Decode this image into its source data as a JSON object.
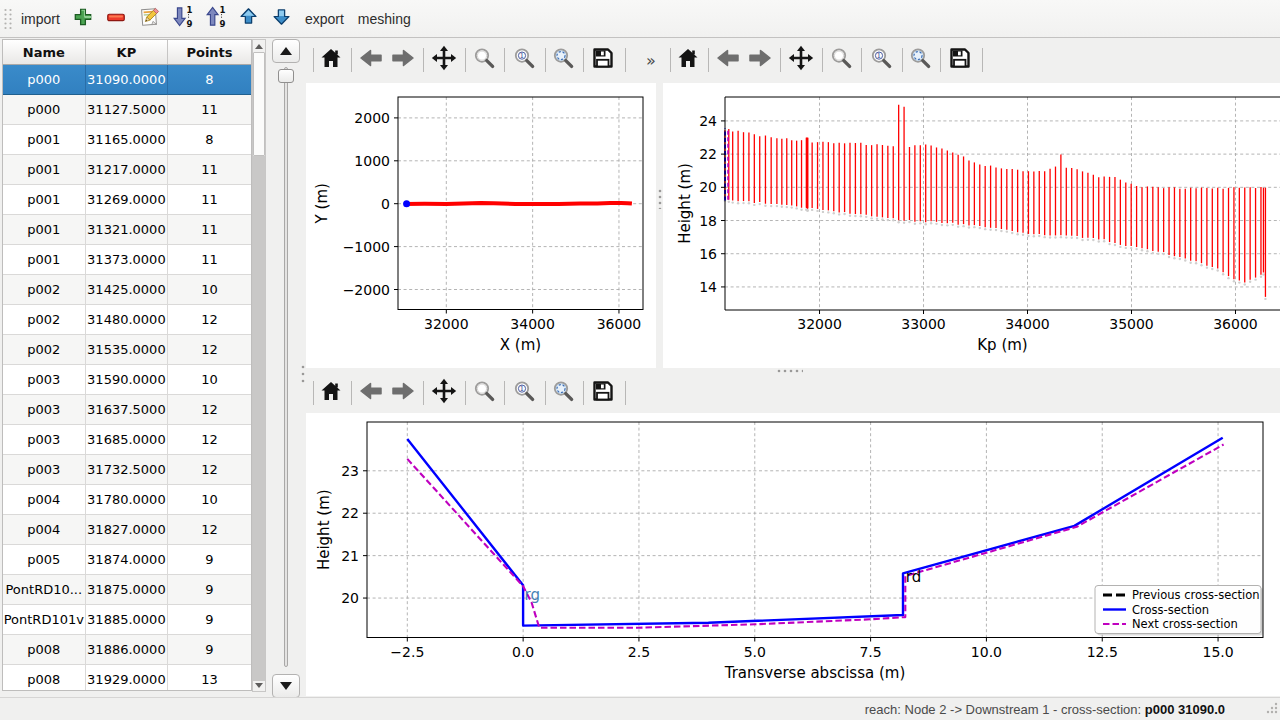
{
  "app": {
    "background": "#f0f0ef",
    "accent": "#3584c6"
  },
  "menubar": {
    "items": [
      {
        "kind": "label",
        "id": "import",
        "label": "import"
      },
      {
        "kind": "icon",
        "id": "add",
        "icon": "add-icon"
      },
      {
        "kind": "icon",
        "id": "delete",
        "icon": "remove-icon"
      },
      {
        "kind": "icon",
        "id": "edit",
        "icon": "edit-icon"
      },
      {
        "kind": "icon",
        "id": "sort-descending",
        "icon": "sort-descending-icon"
      },
      {
        "kind": "icon",
        "id": "sort-ascending",
        "icon": "sort-ascending-icon"
      },
      {
        "kind": "icon",
        "id": "move-up",
        "icon": "arrow-up-icon"
      },
      {
        "kind": "icon",
        "id": "move-down",
        "icon": "arrow-down-icon"
      },
      {
        "kind": "label",
        "id": "export",
        "label": "export"
      },
      {
        "kind": "label",
        "id": "meshing",
        "label": "meshing"
      }
    ]
  },
  "table": {
    "columns": [
      "Name",
      "KP",
      "Points"
    ],
    "selected_row": 0,
    "rows": [
      [
        "p000",
        "31090.0000",
        "8"
      ],
      [
        "p000",
        "31127.5000",
        "11"
      ],
      [
        "p001",
        "31165.0000",
        "8"
      ],
      [
        "p001",
        "31217.0000",
        "11"
      ],
      [
        "p001",
        "31269.0000",
        "11"
      ],
      [
        "p001",
        "31321.0000",
        "11"
      ],
      [
        "p001",
        "31373.0000",
        "11"
      ],
      [
        "p002",
        "31425.0000",
        "10"
      ],
      [
        "p002",
        "31480.0000",
        "12"
      ],
      [
        "p002",
        "31535.0000",
        "12"
      ],
      [
        "p003",
        "31590.0000",
        "10"
      ],
      [
        "p003",
        "31637.5000",
        "12"
      ],
      [
        "p003",
        "31685.0000",
        "12"
      ],
      [
        "p003",
        "31732.5000",
        "12"
      ],
      [
        "p004",
        "31780.0000",
        "10"
      ],
      [
        "p004",
        "31827.0000",
        "12"
      ],
      [
        "p005",
        "31874.0000",
        "9"
      ],
      [
        "PontRD10...",
        "31875.0000",
        "9"
      ],
      [
        "PontRD101v",
        "31885.0000",
        "9"
      ],
      [
        "p008",
        "31886.0000",
        "9"
      ],
      [
        "p008",
        "31929.0000",
        "13"
      ]
    ]
  },
  "plot_toolbar": {
    "buttons": [
      "home-icon",
      "back-icon",
      "forward-icon",
      "pan-icon",
      "zoom-icon",
      "zoom-one-icon",
      "zoom-fit-icon",
      "save-icon"
    ],
    "overflow_label": "»"
  },
  "statusbar": {
    "reach_label": "reach: Node 2 -> Downstream 1 - cross-section: ",
    "current_section": "p000 31090.0"
  },
  "chart_data": [
    {
      "id": "plan-view",
      "type": "line",
      "title": "",
      "xlabel": "X (m)",
      "ylabel": "Y (m)",
      "xlim": [
        30881,
        36557
      ],
      "ylim": [
        -2466,
        2487
      ],
      "xticks": [
        32000,
        34000,
        36000
      ],
      "xtick_labels": [
        "32000",
        "34000",
        "36000"
      ],
      "yticks": [
        -2000,
        -1000,
        0,
        1000,
        2000
      ],
      "ytick_labels": [
        "−2000",
        "−1000",
        "0",
        "1000",
        "2000"
      ],
      "grid": true,
      "series": [
        {
          "name": "river-axis",
          "kind": "line",
          "color": "#ff0000",
          "width": 4,
          "points": [
            [
              31040,
              -8
            ],
            [
              31500,
              -3
            ],
            [
              32000,
              -7
            ],
            [
              32400,
              3
            ],
            [
              32800,
              18
            ],
            [
              33100,
              9
            ],
            [
              33600,
              -6
            ],
            [
              34100,
              -9
            ],
            [
              34600,
              -5
            ],
            [
              35100,
              2
            ],
            [
              35500,
              7
            ],
            [
              35800,
              16
            ],
            [
              36050,
              18
            ],
            [
              36200,
              11
            ],
            [
              36300,
              3
            ]
          ]
        },
        {
          "name": "current-cross-section-marker",
          "kind": "marker",
          "color": "#0000ff",
          "size": 3.5,
          "points": [
            [
              31080,
              -2
            ]
          ]
        }
      ]
    },
    {
      "id": "long-profile",
      "type": "vlines",
      "title": "",
      "xlabel": "Kp (m)",
      "ylabel": "Height (m)",
      "xlim": [
        31091,
        36428
      ],
      "ylim": [
        12.61,
        25.44
      ],
      "xticks": [
        32000,
        33000,
        34000,
        35000,
        36000
      ],
      "xtick_labels": [
        "32000",
        "33000",
        "34000",
        "35000",
        "36000"
      ],
      "yticks": [
        14,
        16,
        18,
        20,
        22,
        24
      ],
      "ytick_labels": [
        "14",
        "16",
        "18",
        "20",
        "22",
        "24"
      ],
      "grid": true,
      "cut_right": true,
      "vline_color": "#ff0000",
      "vline_width": 1.3,
      "bed_dot_color": "#d0cfce",
      "sections": [
        [
          31090,
          19.31,
          23.44
        ],
        [
          31127.5,
          19.25,
          23.52
        ],
        [
          31165,
          19.2,
          23.36
        ],
        [
          31217,
          19.16,
          23.4
        ],
        [
          31269,
          19.17,
          23.32
        ],
        [
          31321,
          19.16,
          23.3
        ],
        [
          31373,
          19.06,
          23.2
        ],
        [
          31425,
          19.11,
          23.08
        ],
        [
          31480,
          19.01,
          23.12
        ],
        [
          31535,
          18.99,
          23.02
        ],
        [
          31590,
          18.99,
          22.96
        ],
        [
          31637.5,
          18.95,
          22.92
        ],
        [
          31685,
          18.93,
          22.96
        ],
        [
          31732.5,
          18.9,
          22.84
        ],
        [
          31780,
          18.85,
          22.81
        ],
        [
          31827,
          18.77,
          22.84
        ],
        [
          31874,
          18.78,
          22.99
        ],
        [
          31875,
          18.75,
          22.99
        ],
        [
          31885,
          18.71,
          22.99
        ],
        [
          31886,
          18.74,
          22.98
        ],
        [
          31929,
          18.76,
          22.7
        ],
        [
          31981.0,
          18.7,
          22.72
        ],
        [
          32033.0,
          18.64,
          22.74
        ],
        [
          32085.0,
          18.61,
          22.72
        ],
        [
          32137.0,
          18.56,
          22.65
        ],
        [
          32189.0,
          18.49,
          22.68
        ],
        [
          32241.0,
          18.51,
          22.65
        ],
        [
          32293.0,
          18.41,
          22.69
        ],
        [
          32345.0,
          18.39,
          22.67
        ],
        [
          32397.0,
          18.38,
          22.68
        ],
        [
          32449.0,
          18.34,
          22.55
        ],
        [
          32501.0,
          18.25,
          22.54
        ],
        [
          32553.0,
          18.23,
          22.6
        ],
        [
          32605.0,
          18.19,
          22.55
        ],
        [
          32657.0,
          18.15,
          22.5
        ],
        [
          32709.0,
          18.14,
          22.47
        ],
        [
          32761.0,
          18.02,
          24.98
        ],
        [
          32813.0,
          17.99,
          24.85
        ],
        [
          32865.0,
          18.03,
          22.43
        ],
        [
          32917.0,
          17.93,
          22.54
        ],
        [
          32969.0,
          17.95,
          22.53
        ],
        [
          33021.0,
          17.9,
          22.58
        ],
        [
          33073.0,
          17.96,
          22.52
        ],
        [
          33125.0,
          17.92,
          22.4
        ],
        [
          33177.0,
          17.85,
          22.34
        ],
        [
          33229.0,
          17.83,
          22.21
        ],
        [
          33281.0,
          17.86,
          22.1
        ],
        [
          33333.0,
          17.75,
          21.96
        ],
        [
          33385.0,
          17.78,
          21.86
        ],
        [
          33437.0,
          17.7,
          21.62
        ],
        [
          33489.0,
          17.72,
          21.5
        ],
        [
          33541.0,
          17.67,
          21.37
        ],
        [
          33593.0,
          17.6,
          21.29
        ],
        [
          33645.0,
          17.56,
          21.31
        ],
        [
          33697.0,
          17.55,
          21.2
        ],
        [
          33749.0,
          17.49,
          21.14
        ],
        [
          33801.0,
          17.45,
          21.11
        ],
        [
          33853.0,
          17.37,
          21.11
        ],
        [
          33905.0,
          17.29,
          21.06
        ],
        [
          33957.0,
          17.26,
          20.97
        ],
        [
          34009.0,
          17.19,
          20.97
        ],
        [
          34061.0,
          17.17,
          20.96
        ],
        [
          34113.0,
          17.19,
          20.98
        ],
        [
          34165.0,
          17.12,
          20.97
        ],
        [
          34217.0,
          17.1,
          21.12
        ],
        [
          34269.0,
          17.1,
          21.25
        ],
        [
          34321.0,
          17.12,
          21.98
        ],
        [
          34373.0,
          17.09,
          21.18
        ],
        [
          34425.0,
          17.08,
          21.17
        ],
        [
          34477.0,
          17.07,
          21.09
        ],
        [
          34529.0,
          16.95,
          20.96
        ],
        [
          34581.0,
          16.96,
          20.88
        ],
        [
          34633.0,
          16.95,
          20.76
        ],
        [
          34685.0,
          16.86,
          20.6
        ],
        [
          34737.0,
          16.87,
          20.65
        ],
        [
          34789.0,
          16.7,
          20.63
        ],
        [
          34841.0,
          16.65,
          20.62
        ],
        [
          34893.0,
          16.53,
          20.46
        ],
        [
          34945.0,
          16.47,
          20.29
        ],
        [
          34997.0,
          16.46,
          20.21
        ],
        [
          35049.0,
          16.4,
          20.08
        ],
        [
          35101.0,
          16.33,
          20.0
        ],
        [
          35153.0,
          16.27,
          20.05
        ],
        [
          35205.0,
          16.17,
          20.03
        ],
        [
          35257.0,
          16.12,
          20.01
        ],
        [
          35309.0,
          16.1,
          19.95
        ],
        [
          35361.0,
          15.92,
          20.0
        ],
        [
          35413.0,
          15.85,
          20.0
        ],
        [
          35465.0,
          15.8,
          19.91
        ],
        [
          35517.0,
          15.71,
          19.92
        ],
        [
          35569.0,
          15.58,
          19.97
        ],
        [
          35621.0,
          15.55,
          19.95
        ],
        [
          35673.0,
          15.43,
          19.98
        ],
        [
          35725.0,
          15.28,
          19.96
        ],
        [
          35777.0,
          15.2,
          19.93
        ],
        [
          35829.0,
          15.11,
          19.98
        ],
        [
          35881.0,
          14.88,
          19.92
        ],
        [
          35933.0,
          14.65,
          19.97
        ],
        [
          35985.0,
          14.46,
          20.01
        ],
        [
          36037.0,
          14.38,
          19.98
        ],
        [
          36089.0,
          14.27,
          19.99
        ],
        [
          36141.0,
          14.43,
          20.0
        ],
        [
          36193.0,
          14.56,
          19.96
        ],
        [
          36245.0,
          14.73,
          20.02
        ],
        [
          36269,
          14.87,
          19.97
        ],
        [
          36288,
          13.4,
          19.98
        ]
      ],
      "highlight": [
        {
          "name": "current-cross-section",
          "kp": 31091.5,
          "zmin": 19.2,
          "zmax": 23.55,
          "color": "#0000ff",
          "dash": "4,2.5",
          "width": 1.8
        },
        {
          "name": "next-cross-section",
          "kp": 31120,
          "zmin": 19.25,
          "zmax": 23.5,
          "color": "#bf00bf",
          "dash": "4,2.5",
          "width": 1.6
        }
      ]
    },
    {
      "id": "cross-section",
      "type": "line",
      "title": "",
      "xlabel": "Transverse abscissa (m)",
      "ylabel": "Height (m)",
      "xlim": [
        -3.37,
        15.97
      ],
      "ylim": [
        19.07,
        24.15
      ],
      "xticks": [
        -2.5,
        0.0,
        2.5,
        5.0,
        7.5,
        10.0,
        12.5,
        15.0
      ],
      "xtick_labels": [
        "−2.5",
        "0.0",
        "2.5",
        "5.0",
        "7.5",
        "10.0",
        "12.5",
        "15.0"
      ],
      "yticks": [
        20,
        21,
        22,
        23
      ],
      "ytick_labels": [
        "20",
        "21",
        "22",
        "23"
      ],
      "grid": true,
      "series": [
        {
          "name": "Previous cross-section",
          "kind": "line",
          "color": "#000000",
          "width": 2.8,
          "dash": "9,4",
          "points": []
        },
        {
          "name": "Cross-section",
          "kind": "line",
          "color": "#0000ff",
          "width": 2.4,
          "points": [
            [
              -2.5,
              23.75
            ],
            [
              0.0,
              20.3
            ],
            [
              0.0,
              19.35
            ],
            [
              4.0,
              19.42
            ],
            [
              8.2,
              19.6
            ],
            [
              8.2,
              20.58
            ],
            [
              11.9,
              21.7
            ],
            [
              15.1,
              23.78
            ]
          ]
        },
        {
          "name": "Next cross-section",
          "kind": "line",
          "color": "#bf00bf",
          "width": 2.1,
          "dash": "6.5,3",
          "points": [
            [
              -2.5,
              23.28
            ],
            [
              0.0,
              20.28
            ],
            [
              0.18,
              19.9
            ],
            [
              0.35,
              19.3
            ],
            [
              2.5,
              19.3
            ],
            [
              5.0,
              19.38
            ],
            [
              7.5,
              19.5
            ],
            [
              8.25,
              19.55
            ],
            [
              8.25,
              20.52
            ],
            [
              11.95,
              21.68
            ],
            [
              15.12,
              23.62
            ]
          ]
        }
      ],
      "annotations": [
        {
          "text": "rg",
          "x": 0.03,
          "y": 19.95,
          "color": "#4682b4",
          "size": 15
        },
        {
          "text": "rd",
          "x": 8.26,
          "y": 20.37,
          "color": "#000000",
          "size": 15
        }
      ],
      "legend": {
        "loc": "lower right",
        "entries": [
          "Previous cross-section",
          "Cross-section",
          "Next cross-section"
        ]
      }
    }
  ]
}
